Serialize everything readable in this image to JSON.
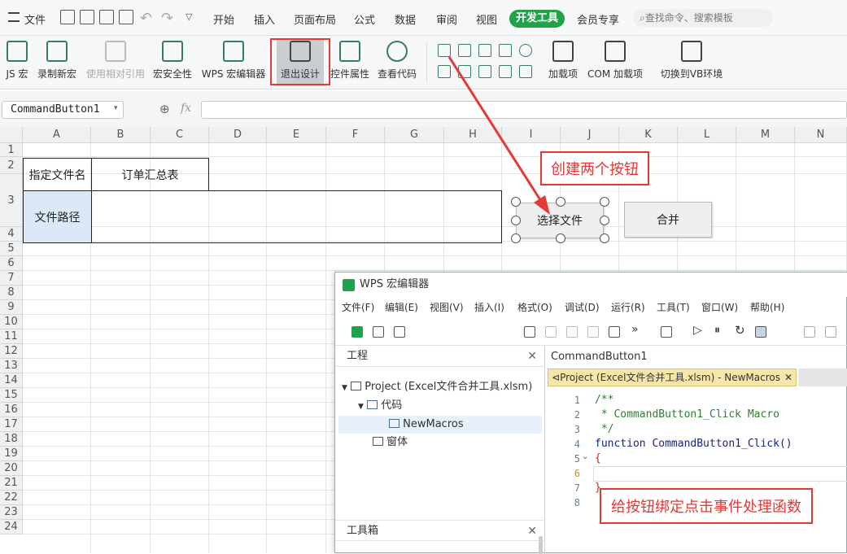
{
  "menubar": {
    "file": "文件",
    "tabs": [
      "开始",
      "插入",
      "页面布局",
      "公式",
      "数据",
      "审阅",
      "视图"
    ],
    "active_tab": "开发工具",
    "member": "会员专享",
    "search": "查找命令、搜索模板"
  },
  "ribbon": {
    "js_macro": "JS 宏",
    "record": "录制新宏",
    "relative": "使用相对引用",
    "security": "宏安全性",
    "wps_editor": "WPS 宏编辑器",
    "exit_design": "退出设计",
    "control_props": "控件属性",
    "view_code": "查看代码",
    "addins": "加载项",
    "com_addins": "COM 加载项",
    "switch_vb": "切换到VB环境"
  },
  "formula": {
    "name_box": "CommandButton1",
    "fx": "fx"
  },
  "columns": [
    "A",
    "B",
    "C",
    "D",
    "E",
    "F",
    "G",
    "H",
    "I",
    "J",
    "K",
    "L",
    "M",
    "N"
  ],
  "rows": [
    "1",
    "2",
    "3",
    "4",
    "5",
    "6",
    "7",
    "8",
    "9",
    "10",
    "11",
    "12",
    "13",
    "14",
    "15",
    "16",
    "17",
    "18",
    "19",
    "20",
    "21",
    "22",
    "23",
    "24"
  ],
  "cells": {
    "a2": "指定文件名",
    "b2": "订单汇总表",
    "a3": "文件路径"
  },
  "buttons": {
    "select_file": "选择文件",
    "merge": "合并"
  },
  "callouts": {
    "create": "创建两个按钮",
    "bind": "给按钮绑定点击事件处理函数"
  },
  "editor": {
    "title": "WPS 宏编辑器",
    "menu": [
      "文件(F)",
      "编辑(E)",
      "视图(V)",
      "插入(I)",
      "格式(O)",
      "调试(D)",
      "运行(R)",
      "工具(T)",
      "窗口(W)",
      "帮助(H)"
    ],
    "project_title": "工程",
    "project_root": "Project (Excel文件合并工具.xlsm)",
    "code_folder": "代码",
    "module": "NewMacros",
    "forms": "窗体",
    "toolbox_title": "工具箱",
    "object_name": "CommandButton1",
    "doc_tab": "Project (Excel文件合并工具.xlsm) - NewMacros",
    "line_numbers": [
      "1",
      "2",
      "3",
      "4",
      "5",
      "6",
      "7",
      "8"
    ],
    "code_lines": [
      "/**",
      " * CommandButton1_Click Macro",
      " */",
      "function CommandButton1_Click()",
      "{",
      "",
      "}",
      ""
    ]
  }
}
